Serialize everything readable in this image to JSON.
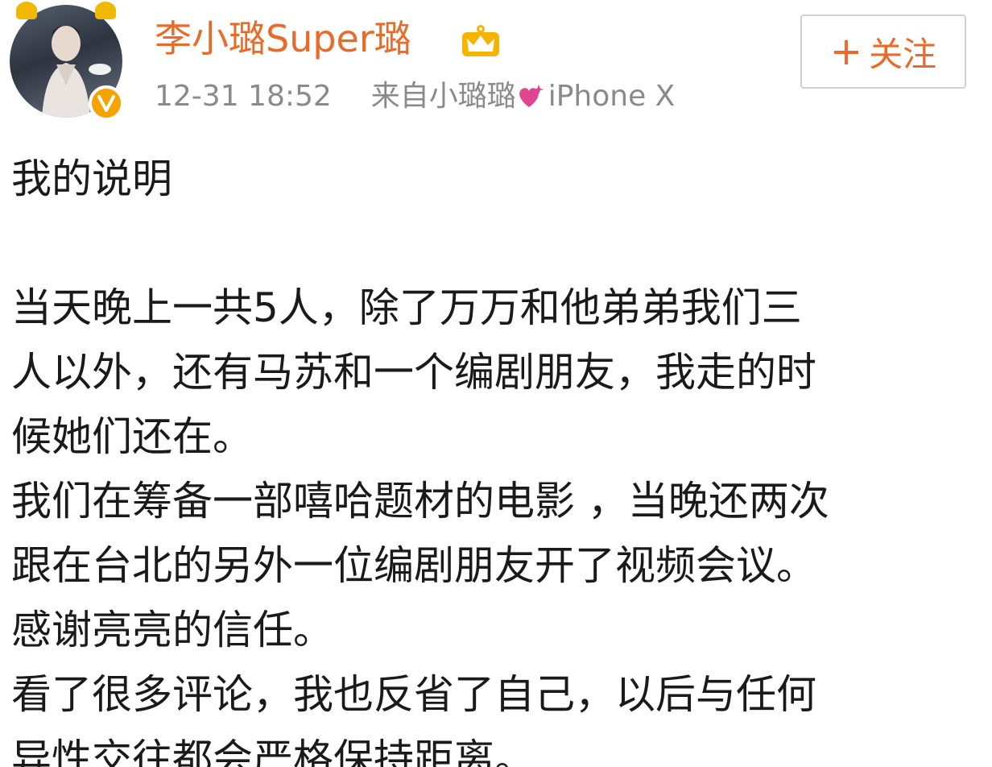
{
  "post": {
    "username": "李小璐Super璐",
    "timestamp": "12-31 18:52",
    "source_prefix": "来自小璐璐",
    "source_device": "iPhone X",
    "follow_button": "+ 关注",
    "follow_label": "关注",
    "follow_plus": "+",
    "body_lines": [
      "我的说明",
      "",
      "当天晚上一共5人，除了万万和他弟弟我们三",
      "人以外，还有马苏和一个编剧朋友，我走的时",
      "候她们还在。",
      "我们在筹备一部嘻哈题材的电影 ，当晚还两次",
      "跟在台北的另外一位编剧朋友开了视频会议。",
      "感谢亮亮的信任。",
      "看了很多评论，我也反省了自己，以后与任何",
      "异性交往都会严格保持距离。"
    ]
  },
  "icons": {
    "avatar": "user-avatar",
    "verified": "verified-badge-icon",
    "crown": "crown-icon",
    "heart": "sparkle-heart-icon"
  },
  "colors": {
    "username": "#e86b2b",
    "meta": "#8a8a8a",
    "body": "#1a1a1a",
    "verified": "#f6a300",
    "heart": "#e0458f"
  }
}
